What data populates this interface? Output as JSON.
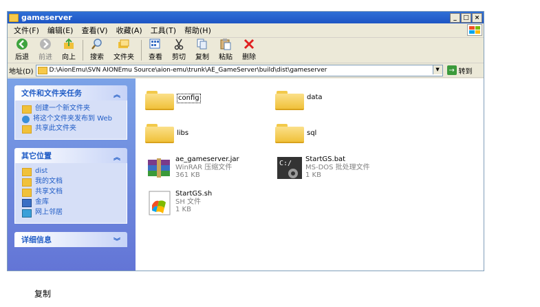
{
  "window": {
    "title": "gameserver",
    "buttons": [
      "_",
      "□",
      "×"
    ]
  },
  "menu": [
    "文件(F)",
    "编辑(E)",
    "查看(V)",
    "收藏(A)",
    "工具(T)",
    "帮助(H)"
  ],
  "toolbar": {
    "back": "后退",
    "forward": "前进",
    "up": "向上",
    "search": "搜索",
    "folders": "文件夹",
    "view": "查看",
    "cut": "剪切",
    "copy": "复制",
    "paste": "粘贴",
    "delete": "删除"
  },
  "address": {
    "label": "地址(D)",
    "path": "D:\\AionEmu\\SVN AIONEmu Source\\aion-emu\\trunk\\AE_GameServer\\build\\dist\\gameserver",
    "go": "转到"
  },
  "tasks": {
    "title": "文件和文件夹任务",
    "items": [
      "创建一个新文件夹",
      "将这个文件夹发布到 Web",
      "共享此文件夹"
    ]
  },
  "places": {
    "title": "其它位置",
    "items": [
      "dist",
      "我的文档",
      "共享文档",
      "金库",
      "网上邻居"
    ]
  },
  "details": {
    "title": "详细信息"
  },
  "files": [
    {
      "name": "config",
      "type": "",
      "size": ""
    },
    {
      "name": "data",
      "type": "",
      "size": ""
    },
    {
      "name": "libs",
      "type": "",
      "size": ""
    },
    {
      "name": "sql",
      "type": "",
      "size": ""
    },
    {
      "name": "ae_gameserver.jar",
      "type": "WinRAR 压缩文件",
      "size": "361 KB"
    },
    {
      "name": "StartGS.bat",
      "type": "MS-DOS 批处理文件",
      "size": "1 KB"
    },
    {
      "name": "StartGS.sh",
      "type": "SH 文件",
      "size": "1 KB"
    }
  ],
  "status": "复制",
  "colors": {
    "title_blue": "#1d55c4",
    "folder_yellow": "#f0c13a",
    "task_blue": "#215dc6",
    "delete_red": "#e02020"
  }
}
